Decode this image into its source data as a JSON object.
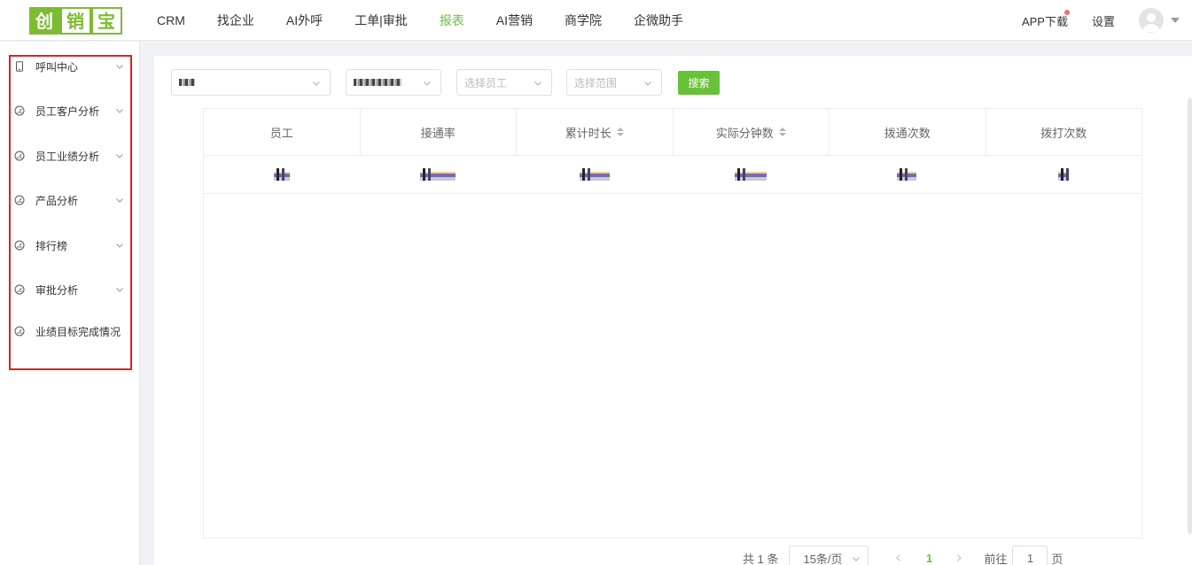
{
  "header": {
    "logo": [
      "创",
      "销",
      "宝"
    ],
    "nav": [
      "CRM",
      "找企业",
      "AI外呼",
      "工单|审批",
      "报表",
      "AI营销",
      "商学院",
      "企微助手"
    ],
    "active_nav": "报表",
    "app_download": "APP下载",
    "settings": "设置"
  },
  "sidebar": {
    "items": [
      {
        "label": "呼叫中心",
        "icon": "phone-icon",
        "expandable": true
      },
      {
        "label": "员工客户分析",
        "icon": "dashboard-icon",
        "expandable": true
      },
      {
        "label": "员工业绩分析",
        "icon": "dashboard-icon",
        "expandable": true
      },
      {
        "label": "产品分析",
        "icon": "dashboard-icon",
        "expandable": true
      },
      {
        "label": "排行榜",
        "icon": "dashboard-icon",
        "expandable": true
      },
      {
        "label": "审批分析",
        "icon": "dashboard-icon",
        "expandable": true
      },
      {
        "label": "业绩目标完成情况",
        "icon": "dashboard-icon",
        "expandable": false
      }
    ]
  },
  "filters": {
    "employee_placeholder": "选择员工",
    "range_placeholder": "选择范围",
    "search_label": "搜索"
  },
  "table": {
    "columns": [
      {
        "label": "员工",
        "sortable": false
      },
      {
        "label": "接通率",
        "sortable": false
      },
      {
        "label": "累计时长",
        "sortable": true
      },
      {
        "label": "实际分钟数",
        "sortable": true
      },
      {
        "label": "拨通次数",
        "sortable": false
      },
      {
        "label": "拨打次数",
        "sortable": false
      }
    ]
  },
  "pagination": {
    "total": "共 1 条",
    "page_size": "15条/页",
    "current_page": "1",
    "goto_prefix": "前往",
    "goto_value": "1",
    "goto_suffix": "页"
  },
  "colors": {
    "accent": "#67c23a",
    "highlight_border": "#e02020"
  }
}
